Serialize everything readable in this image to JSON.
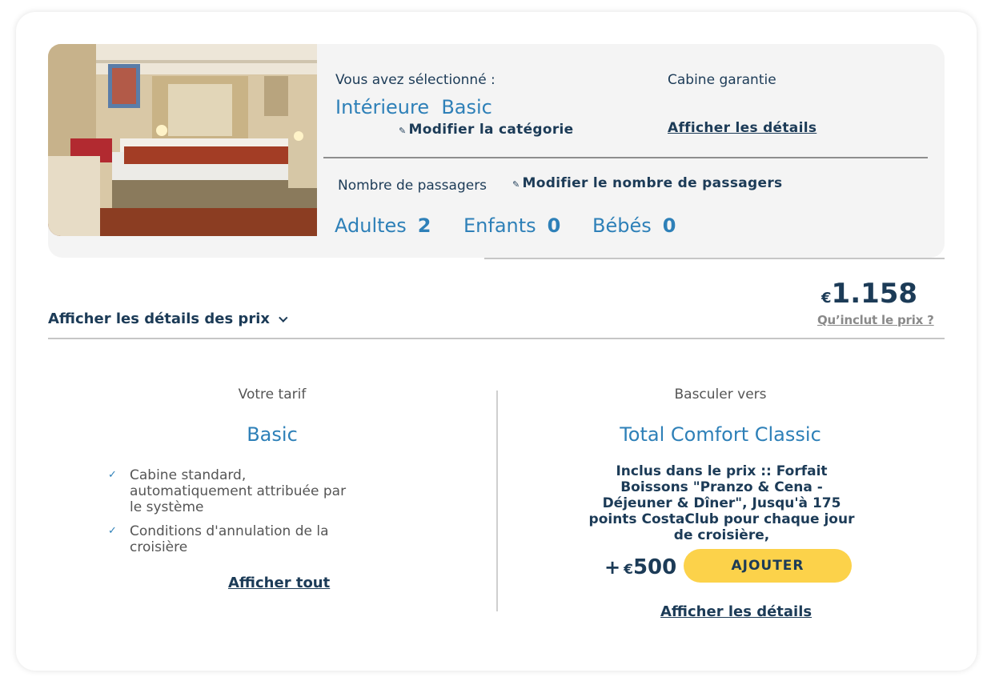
{
  "cabin": {
    "selected_label": "Vous avez sélectionné :",
    "category_name": "Intérieure  Basic",
    "modify_category": "Modifier la catégorie",
    "guarantee_label": "Cabine garantie",
    "show_details": "Afficher les détails"
  },
  "passengers": {
    "label": "Nombre de passagers",
    "modify_label": "Modifier le nombre de passagers",
    "adults_label": "Adultes",
    "adults_count": "2",
    "children_label": "Enfants",
    "children_count": "0",
    "babies_label": "Bébés",
    "babies_count": "0"
  },
  "price": {
    "toggle_label": "Afficher les détails des prix",
    "currency": "€",
    "total": "1.158",
    "includes_link": "Qu’inclut le prix ?"
  },
  "current_fare": {
    "heading": "Votre tarif",
    "name": "Basic",
    "benefits": [
      "Cabine standard, automatiquement attribuée par le système",
      "Conditions d'annulation de la croisière"
    ],
    "show_all": "Afficher tout"
  },
  "upgrade_fare": {
    "heading": "Basculer vers",
    "name": "Total Comfort Classic",
    "included_text": "Inclus dans le prix :: Forfait Boissons \"Pranzo & Cena - Déjeuner & Dîner\", Jusqu'à 175 points CostaClub pour chaque jour de croisière,",
    "plus": "+",
    "currency": "€",
    "price": "500",
    "add_button": "AJOUTER",
    "show_details": "Afficher les détails"
  },
  "icons": {
    "edit": "pencil-icon",
    "check": "check-icon",
    "chevron": "chevron-down-icon"
  },
  "colors": {
    "navy": "#1c3b57",
    "blue": "#2e80b8",
    "button_yellow": "#fcd24a",
    "panel_gray": "#f4f4f4"
  }
}
